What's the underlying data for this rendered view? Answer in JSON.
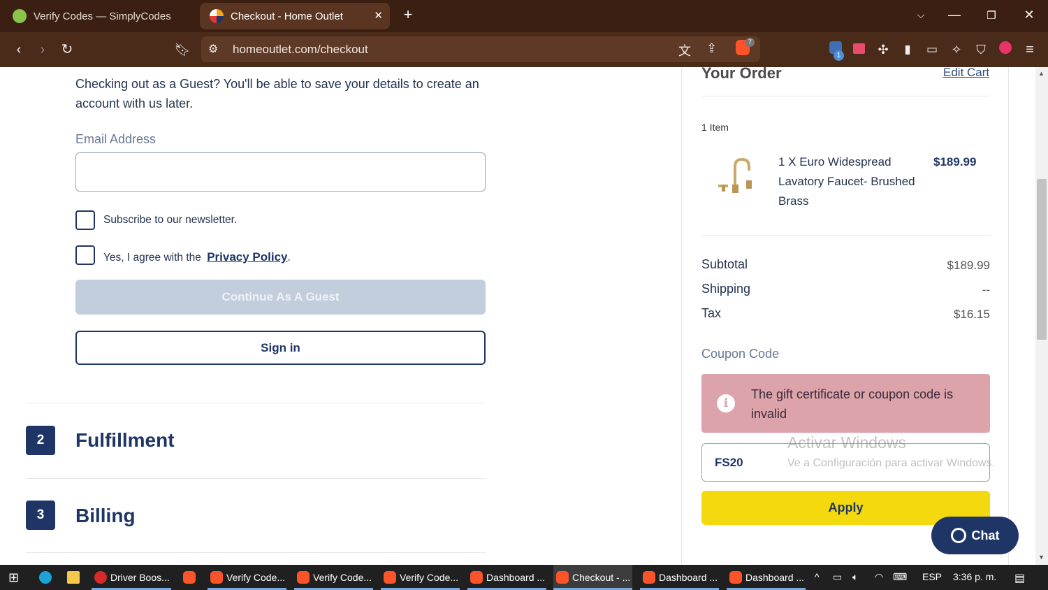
{
  "browser": {
    "tabs": [
      {
        "title": "Verify Codes — SimplyCodes",
        "active": false
      },
      {
        "title": "Checkout - Home Outlet",
        "active": true
      }
    ],
    "new_tab_symbol": "+",
    "url": "homeoutlet.com/checkout",
    "shield_badge": "7",
    "extension_badge": "1"
  },
  "checkout": {
    "guest_text": "Checking out as a Guest? You'll be able to save your details to create an account with us later.",
    "email_label": "Email Address",
    "email_value": "",
    "newsletter_label": "Subscribe to our newsletter.",
    "privacy_prefix": "Yes, I agree with the",
    "privacy_link": "Privacy Policy",
    "privacy_suffix": ".",
    "continue_button": "Continue As A Guest",
    "signin_button": "Sign in",
    "steps": [
      {
        "number": "2",
        "title": "Fulfillment"
      },
      {
        "number": "3",
        "title": "Billing"
      }
    ]
  },
  "order": {
    "title": "Your Order",
    "edit_cart": "Edit Cart",
    "item_count": "1 Item",
    "item_name": "1 X Euro Widespread Lavatory Faucet- Brushed Brass",
    "item_price": "$189.99",
    "subtotal_label": "Subtotal",
    "subtotal_value": "$189.99",
    "shipping_label": "Shipping",
    "shipping_value": "--",
    "tax_label": "Tax",
    "tax_value": "$16.15",
    "coupon_label": "Coupon Code",
    "coupon_error": "The gift certificate or coupon code is invalid",
    "coupon_value": "FS20",
    "apply_button": "Apply"
  },
  "chat_button": "Chat",
  "watermark": {
    "line1": "Activar Windows",
    "line2": "Ve a Configuración para activar Windows."
  },
  "taskbar": {
    "items": [
      {
        "label": "Driver Boos..."
      },
      {
        "label": "Verify Code..."
      },
      {
        "label": "Verify Code..."
      },
      {
        "label": "Verify Code..."
      },
      {
        "label": "Dashboard ..."
      },
      {
        "label": "Checkout - ..."
      },
      {
        "label": "Dashboard ..."
      },
      {
        "label": "Dashboard ..."
      }
    ],
    "language": "ESP",
    "time": "3:36 p. m."
  },
  "colors": {
    "brand_navy": "#1e3566",
    "apply_yellow": "#f5d90f",
    "error_pink": "#dca3aa",
    "browser_brown": "#3a1f12"
  }
}
